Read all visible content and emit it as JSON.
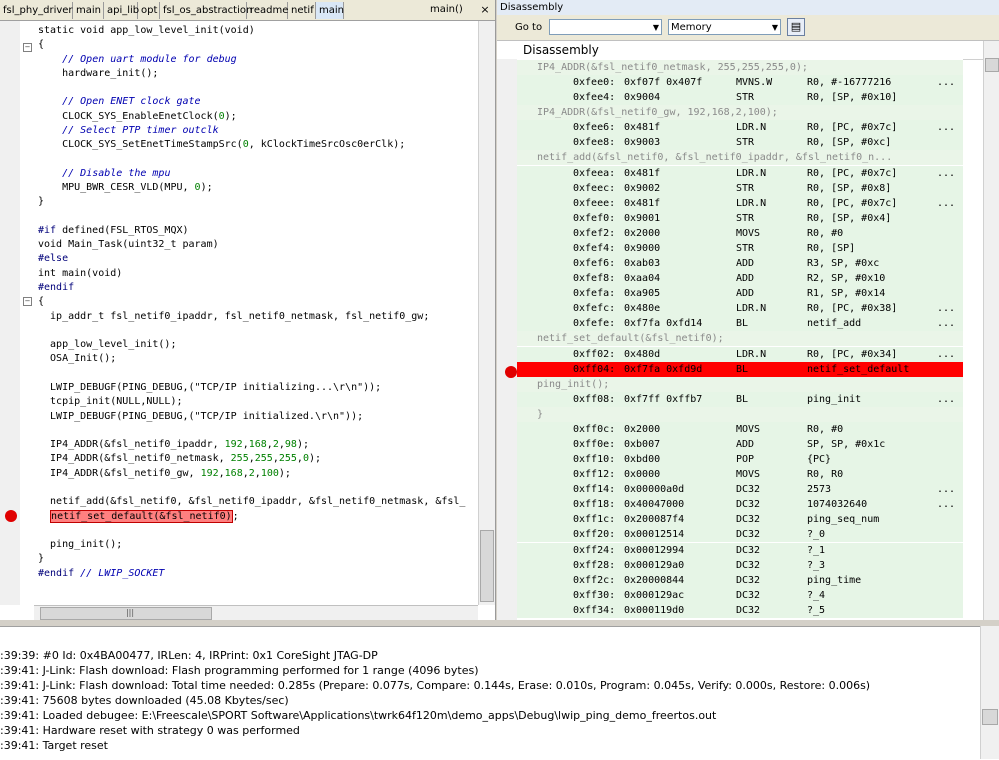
{
  "editor": {
    "tabs": [
      "fsl_phy_driver",
      "main",
      "api_lib",
      "opt",
      "fsl_os_abstraction",
      "readme",
      "netif",
      "main"
    ],
    "active_tab_index": 7,
    "function_selector": "main()",
    "lines": [
      {
        "segs": [
          [
            "static void app_low_level_init(void)",
            ""
          ]
        ]
      },
      {
        "segs": [
          [
            "{",
            ""
          ]
        ]
      },
      {
        "segs": [
          [
            "    ",
            ""
          ],
          [
            "// Open uart module for debug",
            "cm"
          ]
        ]
      },
      {
        "segs": [
          [
            "    hardware_init();",
            ""
          ]
        ]
      },
      {
        "segs": [
          [
            "",
            ""
          ]
        ]
      },
      {
        "segs": [
          [
            "    ",
            ""
          ],
          [
            "// Open ENET clock gate",
            "cm"
          ]
        ]
      },
      {
        "segs": [
          [
            "    CLOCK_SYS_EnableEnetClock(",
            ""
          ],
          [
            "0",
            "num"
          ],
          [
            ");",
            ""
          ]
        ]
      },
      {
        "segs": [
          [
            "    ",
            ""
          ],
          [
            "// Select PTP timer outclk",
            "cm"
          ]
        ]
      },
      {
        "segs": [
          [
            "    CLOCK_SYS_SetEnetTimeStampSrc(",
            ""
          ],
          [
            "0",
            "num"
          ],
          [
            ", kClockTimeSrcOsc0erClk);",
            ""
          ]
        ]
      },
      {
        "segs": [
          [
            "",
            ""
          ]
        ]
      },
      {
        "segs": [
          [
            "    ",
            ""
          ],
          [
            "// Disable the mpu",
            "cm"
          ]
        ]
      },
      {
        "segs": [
          [
            "    MPU_BWR_CESR_VLD(MPU, ",
            ""
          ],
          [
            "0",
            "num"
          ],
          [
            ");",
            ""
          ]
        ]
      },
      {
        "segs": [
          [
            "}",
            ""
          ]
        ]
      },
      {
        "segs": [
          [
            "",
            ""
          ]
        ]
      },
      {
        "segs": [
          [
            "#if",
            "pp"
          ],
          [
            " defined(FSL_RTOS_MQX)",
            ""
          ]
        ]
      },
      {
        "segs": [
          [
            "void Main_Task(uint32_t param)",
            ""
          ]
        ]
      },
      {
        "segs": [
          [
            "#else",
            "pp"
          ]
        ]
      },
      {
        "segs": [
          [
            "int main(void)",
            ""
          ]
        ]
      },
      {
        "segs": [
          [
            "#endif",
            "pp"
          ]
        ]
      },
      {
        "segs": [
          [
            "{",
            ""
          ]
        ]
      },
      {
        "segs": [
          [
            "  ip_addr_t fsl_netif0_ipaddr, fsl_netif0_netmask, fsl_netif0_gw;",
            ""
          ]
        ]
      },
      {
        "segs": [
          [
            "",
            ""
          ]
        ]
      },
      {
        "segs": [
          [
            "  app_low_level_init();",
            ""
          ]
        ]
      },
      {
        "segs": [
          [
            "  OSA_Init();",
            ""
          ]
        ]
      },
      {
        "segs": [
          [
            "",
            ""
          ]
        ]
      },
      {
        "segs": [
          [
            "  LWIP_DEBUGF(PING_DEBUG,(\"TCP/IP initializing...\\r\\n\"));",
            ""
          ]
        ]
      },
      {
        "segs": [
          [
            "  tcpip_init(NULL,NULL);",
            ""
          ]
        ]
      },
      {
        "segs": [
          [
            "  LWIP_DEBUGF(PING_DEBUG,(\"TCP/IP initialized.\\r\\n\"));",
            ""
          ]
        ]
      },
      {
        "segs": [
          [
            "",
            ""
          ]
        ]
      },
      {
        "segs": [
          [
            "  IP4_ADDR(&fsl_netif0_ipaddr, ",
            ""
          ],
          [
            "192",
            "num"
          ],
          [
            ",",
            ""
          ],
          [
            "168",
            "num"
          ],
          [
            ",",
            ""
          ],
          [
            "2",
            "num"
          ],
          [
            ",",
            ""
          ],
          [
            "98",
            "num"
          ],
          [
            ");",
            ""
          ]
        ]
      },
      {
        "segs": [
          [
            "  IP4_ADDR(&fsl_netif0_netmask, ",
            ""
          ],
          [
            "255",
            "num"
          ],
          [
            ",",
            ""
          ],
          [
            "255",
            "num"
          ],
          [
            ",",
            ""
          ],
          [
            "255",
            "num"
          ],
          [
            ",",
            ""
          ],
          [
            "0",
            "num"
          ],
          [
            ");",
            ""
          ]
        ]
      },
      {
        "segs": [
          [
            "  IP4_ADDR(&fsl_netif0_gw, ",
            ""
          ],
          [
            "192",
            "num"
          ],
          [
            ",",
            ""
          ],
          [
            "168",
            "num"
          ],
          [
            ",",
            ""
          ],
          [
            "2",
            "num"
          ],
          [
            ",",
            ""
          ],
          [
            "100",
            "num"
          ],
          [
            ");",
            ""
          ]
        ]
      },
      {
        "segs": [
          [
            "",
            ""
          ]
        ]
      },
      {
        "segs": [
          [
            "  netif_add(&fsl_netif0, &fsl_netif0_ipaddr, &fsl_netif0_netmask, &fsl_",
            ""
          ]
        ]
      },
      {
        "segs": [
          [
            "  ",
            ""
          ],
          [
            "netif_set_default(&fsl_netif0)",
            "hl"
          ],
          [
            ";",
            ""
          ]
        ]
      },
      {
        "segs": [
          [
            "",
            ""
          ]
        ]
      },
      {
        "segs": [
          [
            "  ping_init();",
            ""
          ]
        ]
      },
      {
        "segs": [
          [
            "}",
            ""
          ]
        ]
      },
      {
        "segs": [
          [
            "#endif",
            "pp"
          ],
          [
            " ",
            ""
          ],
          [
            "// LWIP_SOCKET",
            "cm"
          ]
        ]
      }
    ]
  },
  "disassembly": {
    "window_title": "Disassembly",
    "goto_label": "Go to",
    "goto_value": "",
    "memory_label": "Memory",
    "header": "Disassembly",
    "rows": [
      {
        "kind": "src",
        "text": "IP4_ADDR(&fsl_netif0_netmask, 255,255,255,0);"
      },
      {
        "kind": "asm",
        "addr": "0xfee0:",
        "ops": "0xf07f 0x407f",
        "mn": "MVNS.W",
        "arg": "R0, #-16777216",
        "dots": "..."
      },
      {
        "kind": "asm",
        "addr": "0xfee4:",
        "ops": "0x9004",
        "mn": "STR",
        "arg": "R0, [SP, #0x10]",
        "dots": ""
      },
      {
        "kind": "src",
        "text": "IP4_ADDR(&fsl_netif0_gw, 192,168,2,100);"
      },
      {
        "kind": "asm",
        "addr": "0xfee6:",
        "ops": "0x481f",
        "mn": "LDR.N",
        "arg": "R0, [PC, #0x7c]",
        "dots": "..."
      },
      {
        "kind": "asm",
        "addr": "0xfee8:",
        "ops": "0x9003",
        "mn": "STR",
        "arg": "R0, [SP, #0xc]",
        "dots": ""
      },
      {
        "kind": "src",
        "text": "netif_add(&fsl_netif0, &fsl_netif0_ipaddr, &fsl_netif0_n..."
      },
      {
        "kind": "asm",
        "addr": "0xfeea:",
        "ops": "0x481f",
        "mn": "LDR.N",
        "arg": "R0, [PC, #0x7c]",
        "dots": "..."
      },
      {
        "kind": "asm",
        "addr": "0xfeec:",
        "ops": "0x9002",
        "mn": "STR",
        "arg": "R0, [SP, #0x8]",
        "dots": ""
      },
      {
        "kind": "asm",
        "addr": "0xfeee:",
        "ops": "0x481f",
        "mn": "LDR.N",
        "arg": "R0, [PC, #0x7c]",
        "dots": "..."
      },
      {
        "kind": "asm",
        "addr": "0xfef0:",
        "ops": "0x9001",
        "mn": "STR",
        "arg": "R0, [SP, #0x4]",
        "dots": ""
      },
      {
        "kind": "asm",
        "addr": "0xfef2:",
        "ops": "0x2000",
        "mn": "MOVS",
        "arg": "R0, #0",
        "dots": ""
      },
      {
        "kind": "asm",
        "addr": "0xfef4:",
        "ops": "0x9000",
        "mn": "STR",
        "arg": "R0, [SP]",
        "dots": ""
      },
      {
        "kind": "asm",
        "addr": "0xfef6:",
        "ops": "0xab03",
        "mn": "ADD",
        "arg": "R3, SP, #0xc",
        "dots": ""
      },
      {
        "kind": "asm",
        "addr": "0xfef8:",
        "ops": "0xaa04",
        "mn": "ADD",
        "arg": "R2, SP, #0x10",
        "dots": ""
      },
      {
        "kind": "asm",
        "addr": "0xfefa:",
        "ops": "0xa905",
        "mn": "ADD",
        "arg": "R1, SP, #0x14",
        "dots": ""
      },
      {
        "kind": "asm",
        "addr": "0xfefc:",
        "ops": "0x480e",
        "mn": "LDR.N",
        "arg": "R0, [PC, #0x38]",
        "dots": "..."
      },
      {
        "kind": "asm",
        "addr": "0xfefe:",
        "ops": "0xf7fa 0xfd14",
        "mn": "BL",
        "arg": "netif_add",
        "dots": "..."
      },
      {
        "kind": "src",
        "text": "netif_set_default(&fsl_netif0);"
      },
      {
        "kind": "asm",
        "addr": "0xff02:",
        "ops": "0x480d",
        "mn": "LDR.N",
        "arg": "R0, [PC, #0x34]",
        "dots": "..."
      },
      {
        "kind": "cur",
        "addr": "0xff04:",
        "ops": "0xf7fa 0xfd9d",
        "mn": "BL",
        "arg": "netif_set_default",
        "dots": ""
      },
      {
        "kind": "src",
        "text": "ping_init();"
      },
      {
        "kind": "asm",
        "addr": "0xff08:",
        "ops": "0xf7ff 0xffb7",
        "mn": "BL",
        "arg": "ping_init",
        "dots": "..."
      },
      {
        "kind": "src",
        "text": "}"
      },
      {
        "kind": "asm",
        "addr": "0xff0c:",
        "ops": "0x2000",
        "mn": "MOVS",
        "arg": "R0, #0",
        "dots": ""
      },
      {
        "kind": "asm",
        "addr": "0xff0e:",
        "ops": "0xb007",
        "mn": "ADD",
        "arg": "SP, SP, #0x1c",
        "dots": ""
      },
      {
        "kind": "asm",
        "addr": "0xff10:",
        "ops": "0xbd00",
        "mn": "POP",
        "arg": "{PC}",
        "dots": ""
      },
      {
        "kind": "asm",
        "addr": "0xff12:",
        "ops": "0x0000",
        "mn": "MOVS",
        "arg": "R0, R0",
        "dots": ""
      },
      {
        "kind": "asm",
        "addr": "0xff14:",
        "ops": "0x00000a0d",
        "mn": "DC32",
        "arg": "2573",
        "dots": "..."
      },
      {
        "kind": "asm",
        "addr": "0xff18:",
        "ops": "0x40047000",
        "mn": "DC32",
        "arg": "1074032640",
        "dots": "..."
      },
      {
        "kind": "asm",
        "addr": "0xff1c:",
        "ops": "0x200087f4",
        "mn": "DC32",
        "arg": "ping_seq_num",
        "dots": ""
      },
      {
        "kind": "asm",
        "addr": "0xff20:",
        "ops": "0x00012514",
        "mn": "DC32",
        "arg": "?_0",
        "dots": ""
      },
      {
        "kind": "asm",
        "addr": "0xff24:",
        "ops": "0x00012994",
        "mn": "DC32",
        "arg": "?_1",
        "dots": ""
      },
      {
        "kind": "asm",
        "addr": "0xff28:",
        "ops": "0x000129a0",
        "mn": "DC32",
        "arg": "?_3",
        "dots": ""
      },
      {
        "kind": "asm",
        "addr": "0xff2c:",
        "ops": "0x20000844",
        "mn": "DC32",
        "arg": "ping_time",
        "dots": ""
      },
      {
        "kind": "asm",
        "addr": "0xff30:",
        "ops": "0x000129ac",
        "mn": "DC32",
        "arg": "?_4",
        "dots": ""
      },
      {
        "kind": "asm",
        "addr": "0xff34:",
        "ops": "0x000119d0",
        "mn": "DC32",
        "arg": "?_5",
        "dots": ""
      }
    ]
  },
  "log": {
    "lines": [
      ":39:39:  #0 Id: 0x4BA00477, IRLen:  4, IRPrint: 0x1 CoreSight JTAG-DP",
      ":39:41: J-Link: Flash download: Flash programming performed for 1 range (4096 bytes)",
      ":39:41: J-Link: Flash download: Total time needed: 0.285s (Prepare: 0.077s, Compare: 0.144s, Erase: 0.010s, Program: 0.045s, Verify: 0.000s, Restore: 0.006s)",
      ":39:41: 75608 bytes downloaded (45.08 Kbytes/sec)",
      ":39:41: Loaded debugee: E:\\Freescale\\SPORT Software\\Applications\\twrk64f120m\\demo_apps\\Debug\\lwip_ping_demo_freertos.out",
      ":39:41: Hardware reset with strategy 0 was performed",
      ":39:41: Target reset"
    ]
  },
  "colors": {
    "breakpoint": "#e00000",
    "current_statement": "#ff0000",
    "comment": "#0000b0",
    "number_literal": "#008000"
  },
  "icons": {
    "breakpoint_icon": "red-circle",
    "doc_button_icon": "document"
  }
}
